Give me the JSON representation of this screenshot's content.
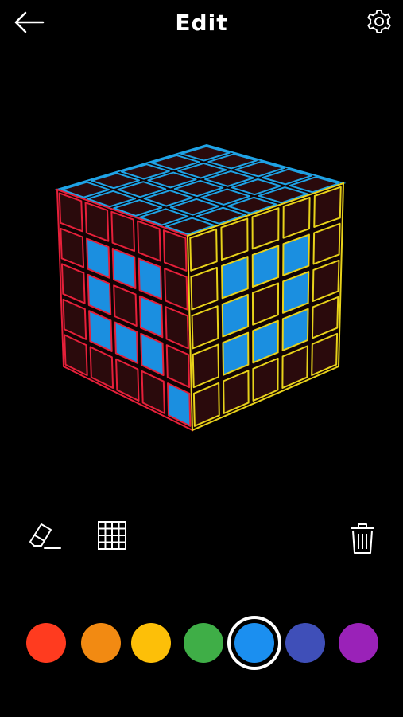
{
  "header": {
    "title": "Edit",
    "back_icon": "arrow-left-icon",
    "settings_icon": "gear-icon"
  },
  "cube": {
    "size": 5,
    "empty_color": "#2a0a0c",
    "top_face": {
      "border_color": "#1fa3e6",
      "cells": [
        [
          "e",
          "e",
          "e",
          "e",
          "e"
        ],
        [
          "e",
          "e",
          "e",
          "e",
          "e"
        ],
        [
          "e",
          "e",
          "e",
          "e",
          "e"
        ],
        [
          "e",
          "e",
          "e",
          "e",
          "e"
        ],
        [
          "e",
          "e",
          "e",
          "e",
          "e"
        ]
      ]
    },
    "left_face": {
      "border_color": "#e6203a",
      "cells": [
        [
          "e",
          "e",
          "e",
          "e",
          "e"
        ],
        [
          "e",
          "b",
          "b",
          "b",
          "e"
        ],
        [
          "e",
          "b",
          "e",
          "b",
          "e"
        ],
        [
          "e",
          "b",
          "b",
          "b",
          "e"
        ],
        [
          "e",
          "e",
          "e",
          "e",
          "b"
        ]
      ]
    },
    "right_face": {
      "border_color": "#e8d21a",
      "cells": [
        [
          "e",
          "e",
          "e",
          "e",
          "e"
        ],
        [
          "e",
          "b",
          "b",
          "b",
          "e"
        ],
        [
          "e",
          "b",
          "e",
          "b",
          "e"
        ],
        [
          "e",
          "b",
          "b",
          "b",
          "e"
        ],
        [
          "e",
          "e",
          "e",
          "e",
          "e"
        ]
      ]
    },
    "fill_colors": {
      "b": "#1b8fe0"
    }
  },
  "toolbar": {
    "eraser_icon": "eraser-icon",
    "grid_icon": "grid-icon",
    "trash_icon": "trash-icon"
  },
  "palette": {
    "selected_index": 4,
    "colors": [
      {
        "name": "red",
        "hex": "#ff3b1f"
      },
      {
        "name": "orange",
        "hex": "#f28a12"
      },
      {
        "name": "yellow",
        "hex": "#fdbf08"
      },
      {
        "name": "green",
        "hex": "#3fae47"
      },
      {
        "name": "blue",
        "hex": "#1b8ff0"
      },
      {
        "name": "indigo",
        "hex": "#3f4fb8"
      },
      {
        "name": "purple",
        "hex": "#9a22b8"
      }
    ]
  }
}
